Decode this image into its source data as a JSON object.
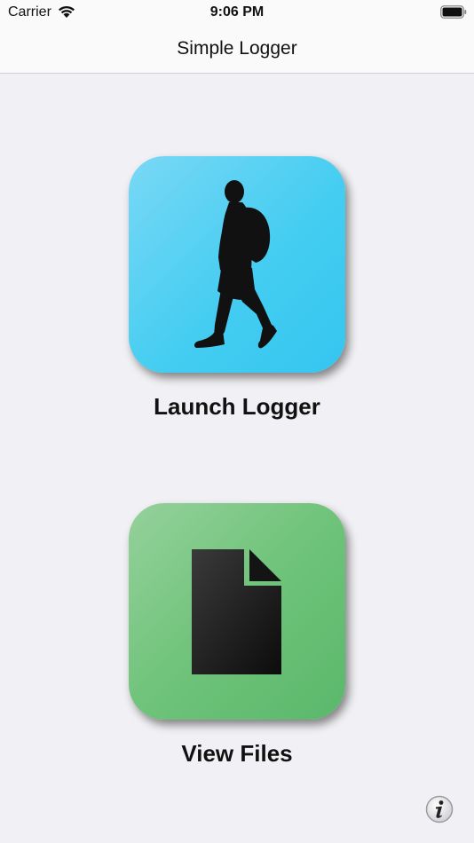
{
  "status_bar": {
    "carrier": "Carrier",
    "time": "9:06 PM",
    "wifi_icon": "wifi-icon",
    "battery_icon": "battery-icon"
  },
  "nav": {
    "title": "Simple Logger"
  },
  "tiles": [
    {
      "label": "Launch Logger",
      "icon": "walking-person-icon",
      "color": "#45cdf1"
    },
    {
      "label": "View Files",
      "icon": "document-icon",
      "color": "#6fc37a"
    }
  ],
  "info_icon": "info-icon"
}
